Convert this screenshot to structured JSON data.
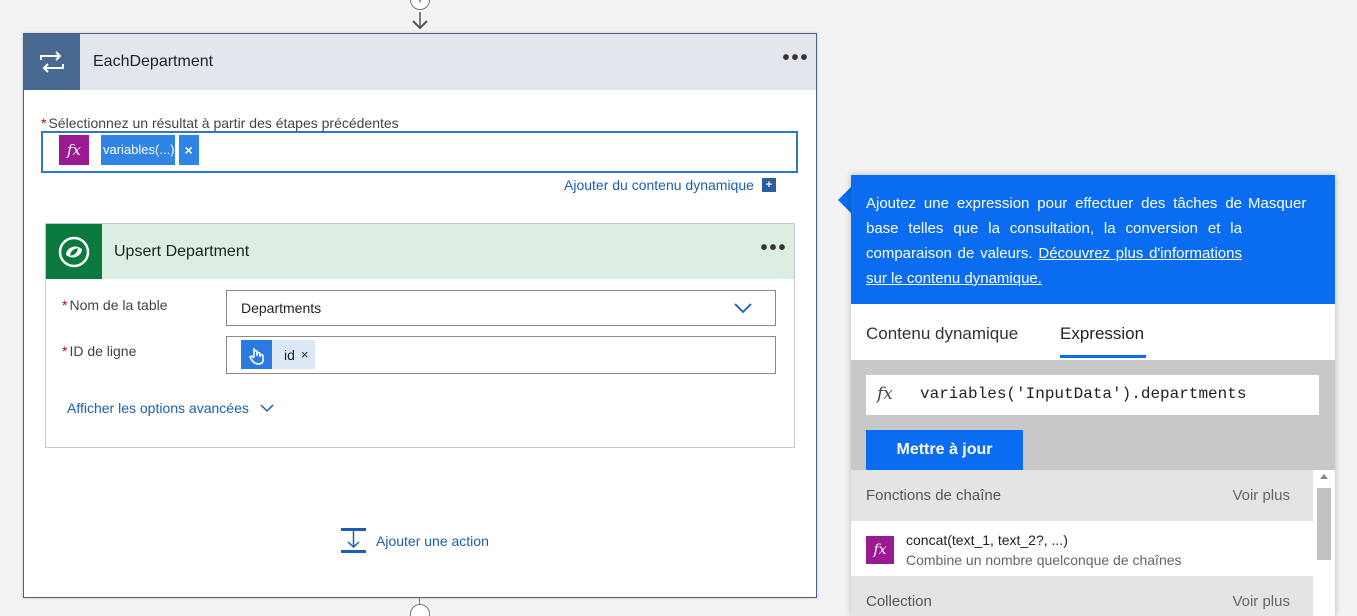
{
  "loop": {
    "title": "EachDepartment",
    "menu_label": "•••",
    "select_label": "Sélectionnez un résultat à partir des étapes précédentes",
    "required_mark": "*",
    "token_icon_label": "fx",
    "token_text": "variables(...)",
    "token_close": "×",
    "add_dynamic": "Ajouter du contenu dynamique",
    "add_dynamic_icon": "+"
  },
  "action": {
    "title": "Upsert Department",
    "menu_label": "•••",
    "table_label": "Nom de la table",
    "table_value": "Departments",
    "row_label": "ID de ligne",
    "row_token": "id",
    "row_token_close": "×",
    "advanced": "Afficher les options avancées"
  },
  "add_action": "Ajouter une action",
  "connector_plus": "+",
  "panel": {
    "description": "Ajoutez une expression pour effectuer des tâches de base telles que la consultation, la conversion et la comparaison de valeurs.",
    "learn_more": "Découvrez plus d'informations sur le contenu dynamique.",
    "hide": "Masquer",
    "tabs": {
      "dynamic": "Contenu dynamique",
      "expression": "Expression"
    },
    "expression_icon": "fx",
    "expression_value": "variables('InputData').departments",
    "update_button": "Mettre à jour",
    "sections": [
      {
        "title": "Fonctions de chaîne",
        "see_more": "Voir plus",
        "items": [
          {
            "icon": "fx",
            "name": "concat(text_1, text_2?, ...)",
            "description": "Combine un nombre quelconque de chaînes"
          }
        ]
      },
      {
        "title": "Collection",
        "see_more": "Voir plus"
      }
    ]
  },
  "colors": {
    "accent": "#0a6cf0",
    "loop_icon_bg": "#486991",
    "dataverse_bg": "#0b7a3f",
    "fx_purple": "#9b1a91"
  }
}
